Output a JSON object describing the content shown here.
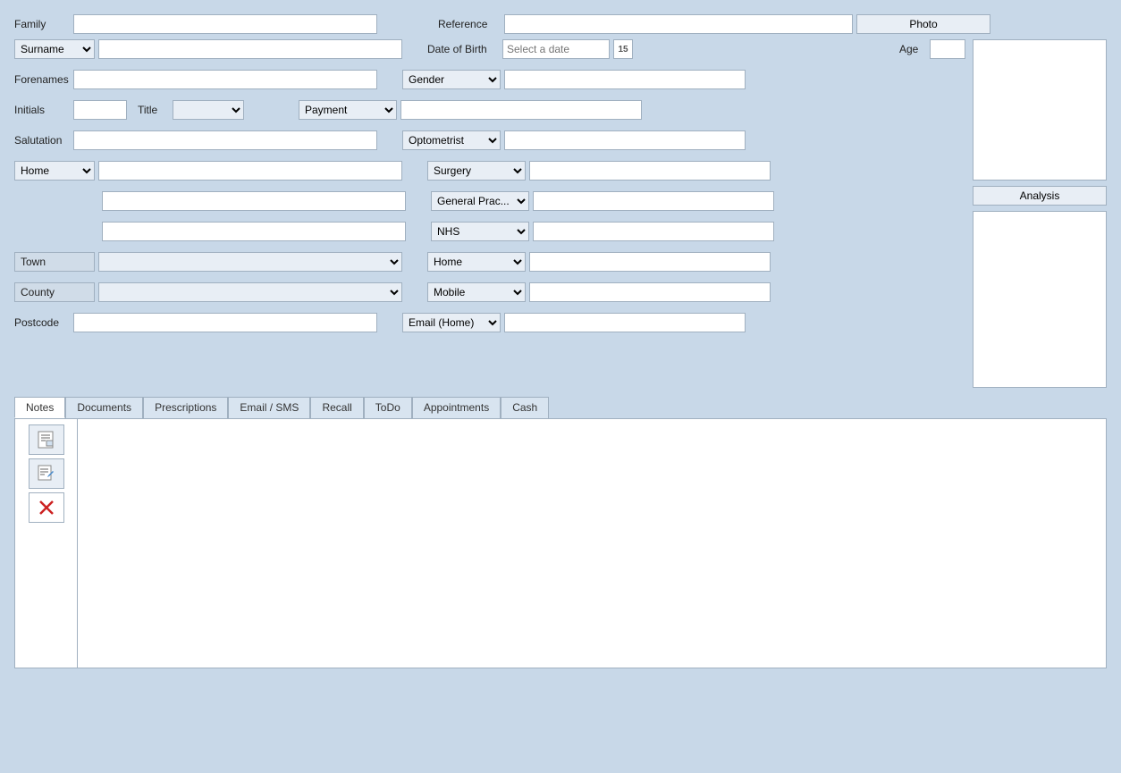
{
  "form": {
    "family_label": "Family",
    "reference_label": "Reference",
    "photo_label": "Photo",
    "analysis_label": "Analysis",
    "surname_label": "Surname",
    "dob_label": "Date of Birth",
    "dob_placeholder": "Select a date",
    "dob_cal": "15",
    "age_label": "Age",
    "forenames_label": "Forenames",
    "gender_label": "Gender",
    "initials_label": "Initials",
    "title_label": "Title",
    "payment_label": "Payment",
    "salutation_label": "Salutation",
    "optometrist_label": "Optometrist",
    "home_label": "Home",
    "surgery_label": "Surgery",
    "general_prac_label": "General Prac...",
    "nhs_label": "NHS",
    "town_label": "Town",
    "home2_label": "Home",
    "county_label": "County",
    "mobile_label": "Mobile",
    "postcode_label": "Postcode",
    "email_home_label": "Email (Home)",
    "surname_options": [
      "Surname"
    ],
    "gender_options": [
      "Gender"
    ],
    "payment_options": [
      "Payment"
    ],
    "optometrist_options": [
      "Optometrist"
    ],
    "home_options": [
      "Home"
    ],
    "surgery_options": [
      "Surgery"
    ],
    "general_prac_options": [
      "General Prac..."
    ],
    "nhs_options": [
      "NHS"
    ],
    "home2_options": [
      "Home"
    ],
    "mobile_options": [
      "Mobile"
    ],
    "email_home_options": [
      "Email (Home)"
    ]
  },
  "tabs": {
    "items": [
      {
        "label": "Notes",
        "active": true
      },
      {
        "label": "Documents",
        "active": false
      },
      {
        "label": "Prescriptions",
        "active": false
      },
      {
        "label": "Email / SMS",
        "active": false
      },
      {
        "label": "Recall",
        "active": false
      },
      {
        "label": "ToDo",
        "active": false
      },
      {
        "label": "Appointments",
        "active": false
      },
      {
        "label": "Cash",
        "active": false
      }
    ]
  },
  "notes_buttons": {
    "new_icon": "📋",
    "edit_icon": "📝",
    "delete_icon": "✖"
  }
}
